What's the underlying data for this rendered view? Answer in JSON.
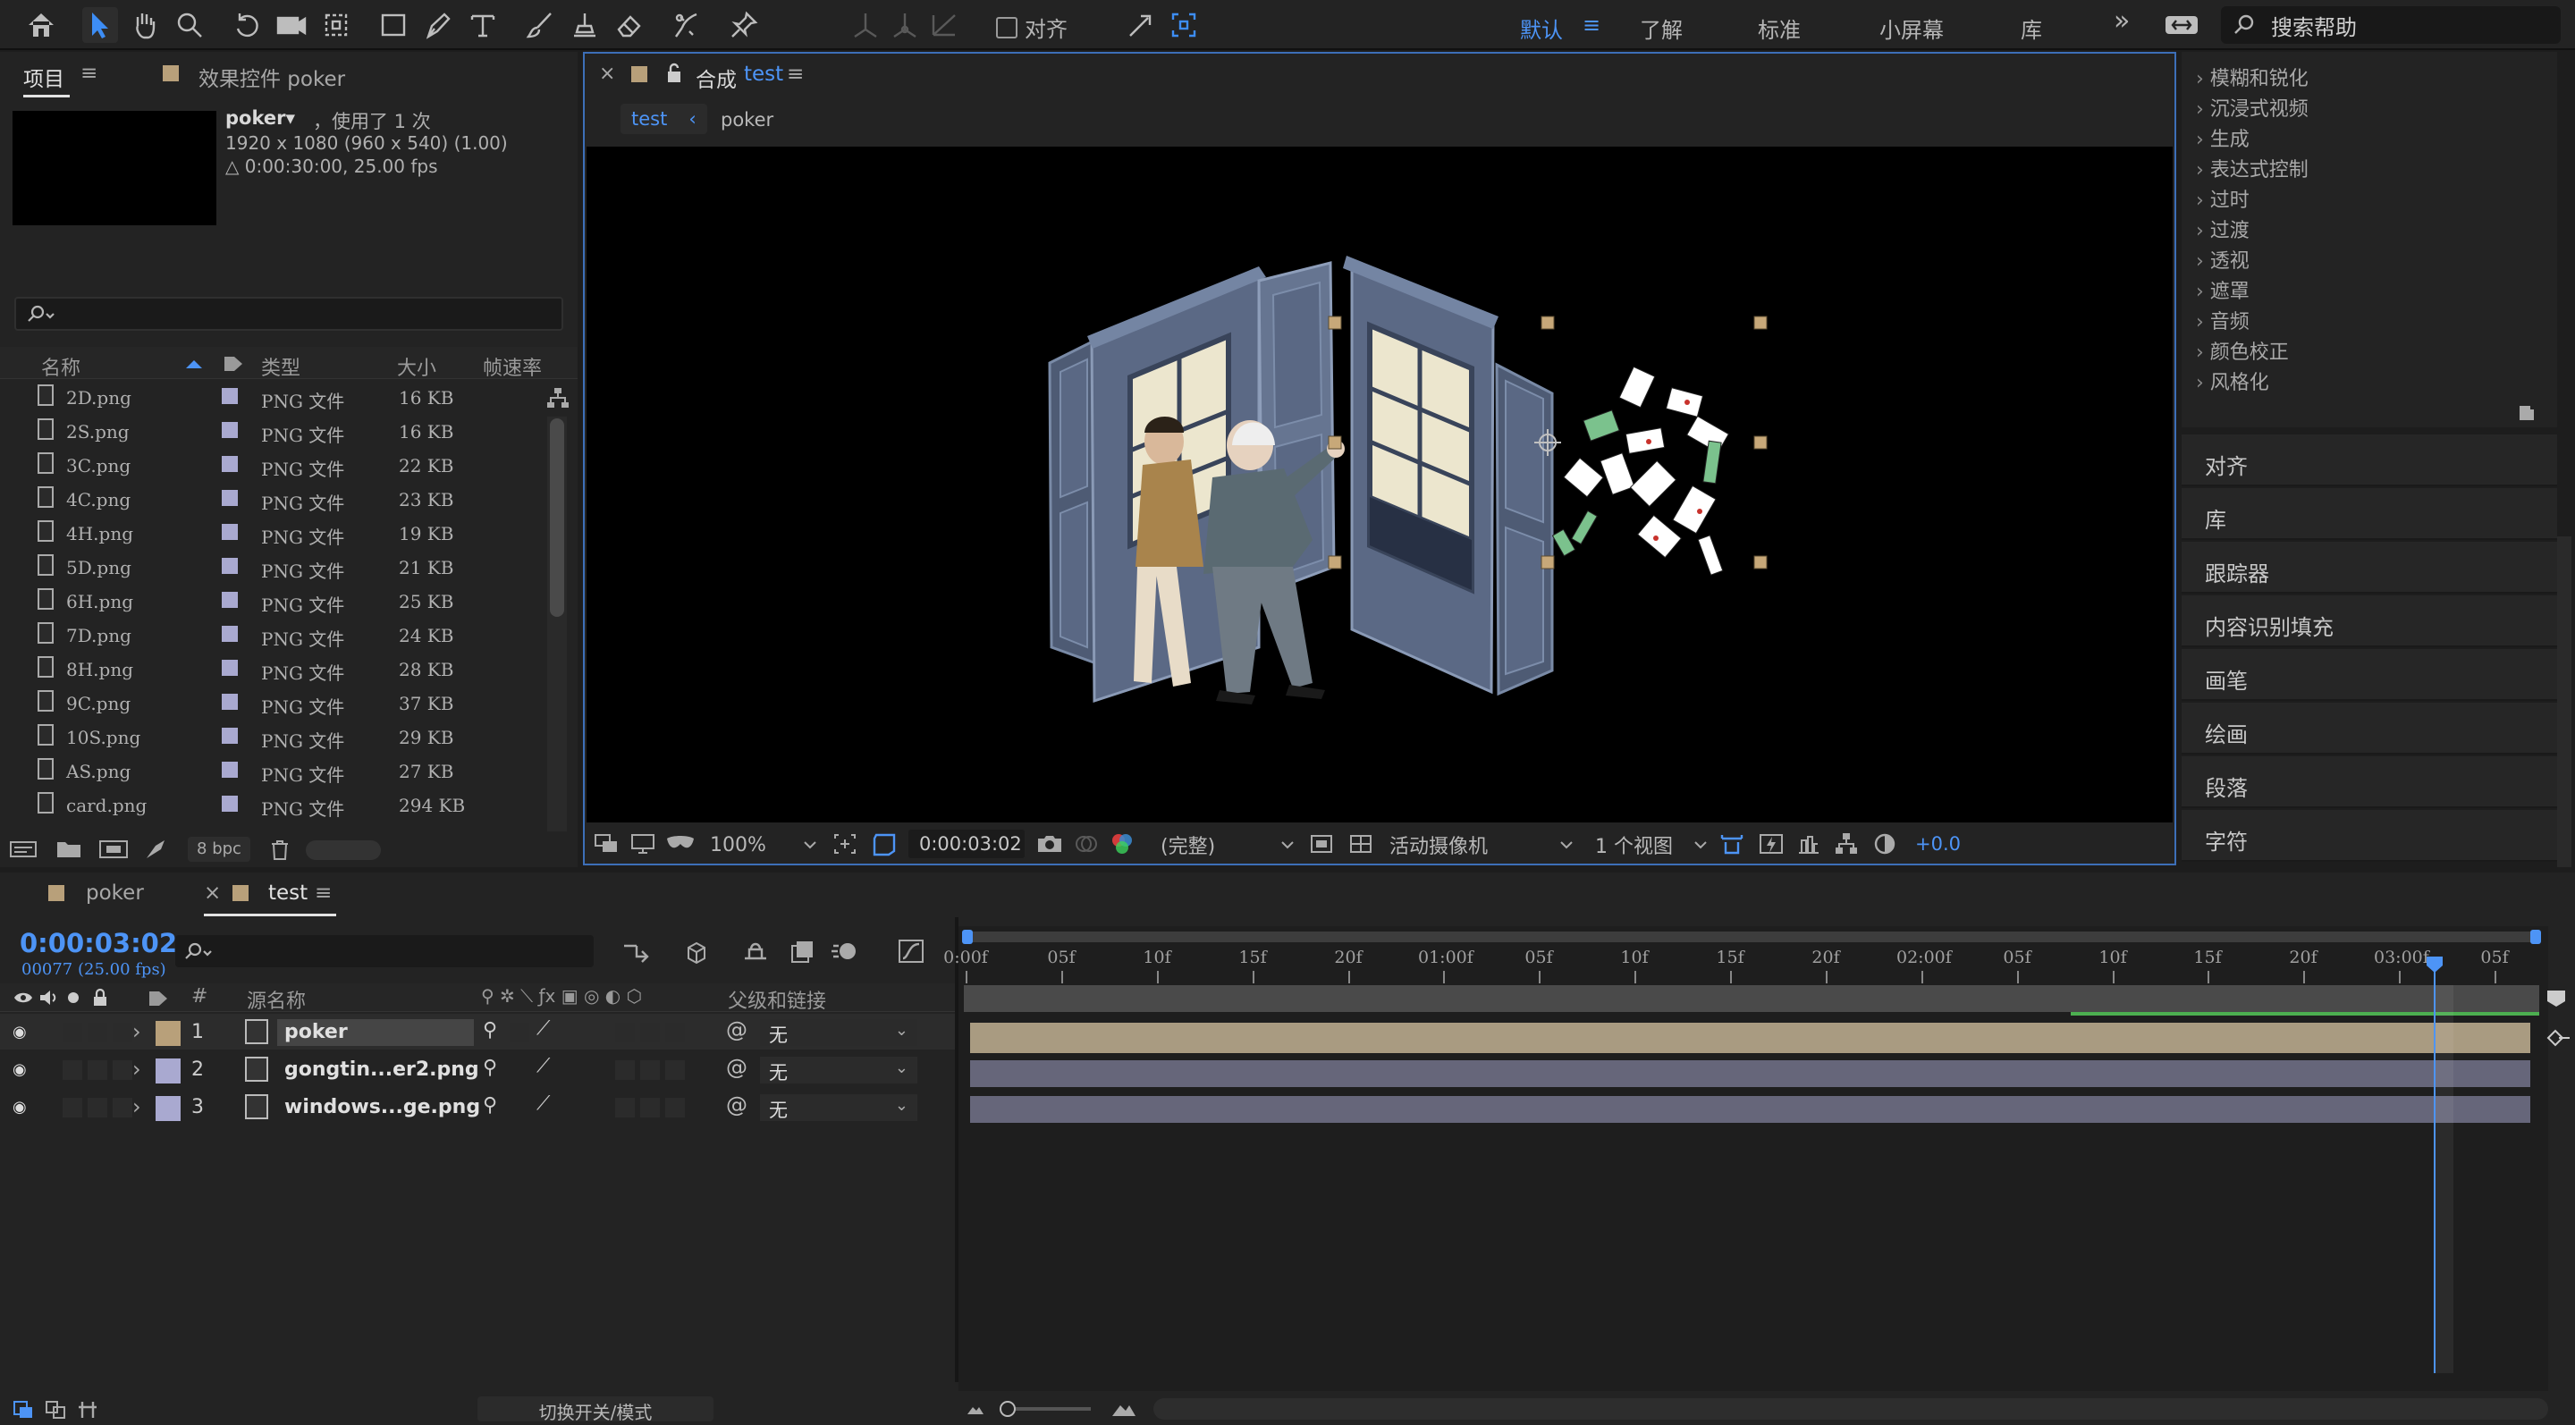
{
  "toolbar": {
    "align_label": "对齐",
    "workspaces": [
      "默认",
      "了解",
      "标准",
      "小屏幕",
      "库"
    ],
    "more": "»",
    "search_placeholder": "搜索帮助"
  },
  "project": {
    "tab_project": "项目",
    "tab_effects": "效果控件 poker",
    "item_name": "poker▾",
    "item_used": "，使用了 1 次",
    "item_dims": "1920 x 1080  (960 x 540) (1.00)",
    "item_duration": "△ 0:00:30:00, 25.00 fps",
    "columns": [
      "名称",
      "类型",
      "大小",
      "帧速率"
    ],
    "files": [
      {
        "name": "2D.png",
        "type": "PNG 文件",
        "size": "16 KB"
      },
      {
        "name": "2S.png",
        "type": "PNG 文件",
        "size": "16 KB"
      },
      {
        "name": "3C.png",
        "type": "PNG 文件",
        "size": "22 KB"
      },
      {
        "name": "4C.png",
        "type": "PNG 文件",
        "size": "23 KB"
      },
      {
        "name": "4H.png",
        "type": "PNG 文件",
        "size": "19 KB"
      },
      {
        "name": "5D.png",
        "type": "PNG 文件",
        "size": "21 KB"
      },
      {
        "name": "6H.png",
        "type": "PNG 文件",
        "size": "25 KB"
      },
      {
        "name": "7D.png",
        "type": "PNG 文件",
        "size": "24 KB"
      },
      {
        "name": "8H.png",
        "type": "PNG 文件",
        "size": "28 KB"
      },
      {
        "name": "9C.png",
        "type": "PNG 文件",
        "size": "37 KB"
      },
      {
        "name": "10S.png",
        "type": "PNG 文件",
        "size": "29 KB"
      },
      {
        "name": "AS.png",
        "type": "PNG 文件",
        "size": "27 KB"
      },
      {
        "name": "card.png",
        "type": "PNG 文件",
        "size": "294 KB"
      }
    ],
    "bpc": "8 bpc"
  },
  "comp": {
    "close": "×",
    "title_prefix": "合成",
    "title_name": "test",
    "crumb_active": "test",
    "crumb_next": "poker",
    "zoom": "100%",
    "timecode": "0:00:03:02",
    "resolution": "(完整)",
    "camera": "活动摄像机",
    "views": "1 个视图",
    "exposure": "+0.0"
  },
  "effects_list": [
    "模糊和锐化",
    "沉浸式视频",
    "生成",
    "表达式控制",
    "过时",
    "过渡",
    "透视",
    "遮罩",
    "音频",
    "颜色校正",
    "风格化"
  ],
  "right_panels": [
    "对齐",
    "库",
    "跟踪器",
    "内容识别填充",
    "画笔",
    "绘画",
    "段落",
    "字符"
  ],
  "timeline": {
    "tab_poker": "poker",
    "tab_test": "test",
    "timecode": "0:00:03:02",
    "frames": "00077 (25.00 fps)",
    "col_source": "源名称",
    "col_parent": "父级和链接",
    "ruler": [
      "0:00f",
      "05f",
      "10f",
      "15f",
      "20f",
      "01:00f",
      "05f",
      "10f",
      "15f",
      "20f",
      "02:00f",
      "05f",
      "10f",
      "15f",
      "20f",
      "03:00f",
      "05f"
    ],
    "layers": [
      {
        "num": "1",
        "name": "poker",
        "parent": "无",
        "color": "#b8a07a"
      },
      {
        "num": "2",
        "name": "gongtin...er2.png",
        "parent": "无",
        "color": "#a9a9d0"
      },
      {
        "num": "3",
        "name": "windows...ge.png",
        "parent": "无",
        "color": "#a9a9d0"
      }
    ],
    "toggle_label": "切换开关/模式"
  }
}
